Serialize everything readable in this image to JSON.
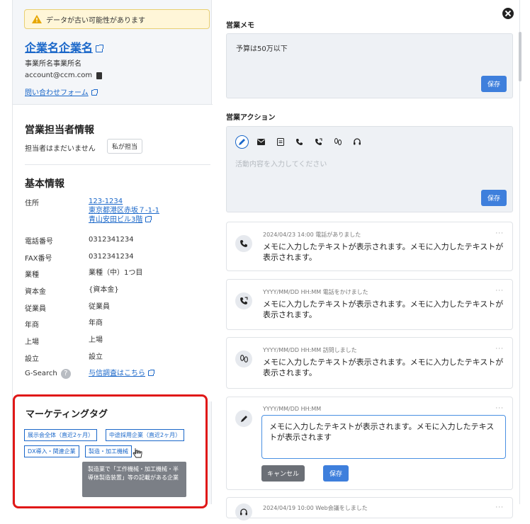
{
  "warning": {
    "text": "データが古い可能性があります"
  },
  "company": {
    "name": "企業名企業名",
    "office": "事業所名事業所名",
    "email": "account@ccm.com",
    "contact_link": "問い合わせフォーム"
  },
  "sales_rep": {
    "title": "営業担当者情報",
    "status": "担当者はまだいません",
    "assign_button": "私が担当"
  },
  "basic_info": {
    "title": "基本情報",
    "rows": [
      {
        "label": "住所",
        "value": "123-1234\n東京都港区赤坂７-1-1\n青山安田ビル3階"
      },
      {
        "label": "電話番号",
        "value": "0312341234"
      },
      {
        "label": "FAX番号",
        "value": "0312341234"
      },
      {
        "label": "業種",
        "value": "業種（中）1つ目"
      },
      {
        "label": "資本金",
        "value": "{資本金}"
      },
      {
        "label": "従業員",
        "value": "従業員"
      },
      {
        "label": "年商",
        "value": "年商"
      },
      {
        "label": "上場",
        "value": "上場"
      },
      {
        "label": "設立",
        "value": "設立"
      },
      {
        "label": "G-Search",
        "value": "与信調査はこちら"
      }
    ],
    "address_lines": [
      "123-1234",
      "東京都港区赤坂７-1-1",
      "青山安田ビル3階"
    ]
  },
  "marketing": {
    "title": "マーケティングタグ",
    "tags": [
      "展示会全体（直近2ヶ月）",
      "中途採用企業（直近2ヶ月）",
      "DX導入・関連企業",
      "製造・加工機械"
    ],
    "tooltip": "製造業で「工作機械・加工機械・半導体製造装置」等の記載がある企業"
  },
  "memo": {
    "label": "営業メモ",
    "text": "予算は50万以下",
    "save": "保存"
  },
  "action": {
    "label": "営業アクション",
    "placeholder": "活動内容を入力してください",
    "save": "保存",
    "icons": [
      "pencil-icon",
      "mail-icon",
      "document-icon",
      "phone-incoming-icon",
      "phone-outgoing-icon",
      "footprints-icon",
      "headset-icon"
    ]
  },
  "logs": [
    {
      "meta": "2024/04/23 14:00  電話がありました",
      "body": "メモに入力したテキストが表示されます。メモに入力したテキストが表示されます。",
      "icon": "phone-incoming-icon"
    },
    {
      "meta": "YYYY/MM/DD HH:MM  電話をかけました",
      "body": "メモに入力したテキストが表示されます。メモに入力したテキストが表示されます。",
      "icon": "phone-outgoing-icon"
    },
    {
      "meta": "YYYY/MM/DD HH:MM  訪問しました",
      "body": "メモに入力したテキストが表示されます。メモに入力したテキストが表示されます。",
      "icon": "footprints-icon"
    },
    {
      "meta": "YYYY/MM/DD HH:MM",
      "body": "メモに入力したテキストが表示されます。メモに入力したテキストが表示されます",
      "icon": "pencil-icon",
      "cancel": "キャンセル",
      "save": "保存"
    },
    {
      "meta": "2024/04/19 10:00  Web会議をしました",
      "icon": "headset-icon"
    }
  ],
  "more_label": "···"
}
